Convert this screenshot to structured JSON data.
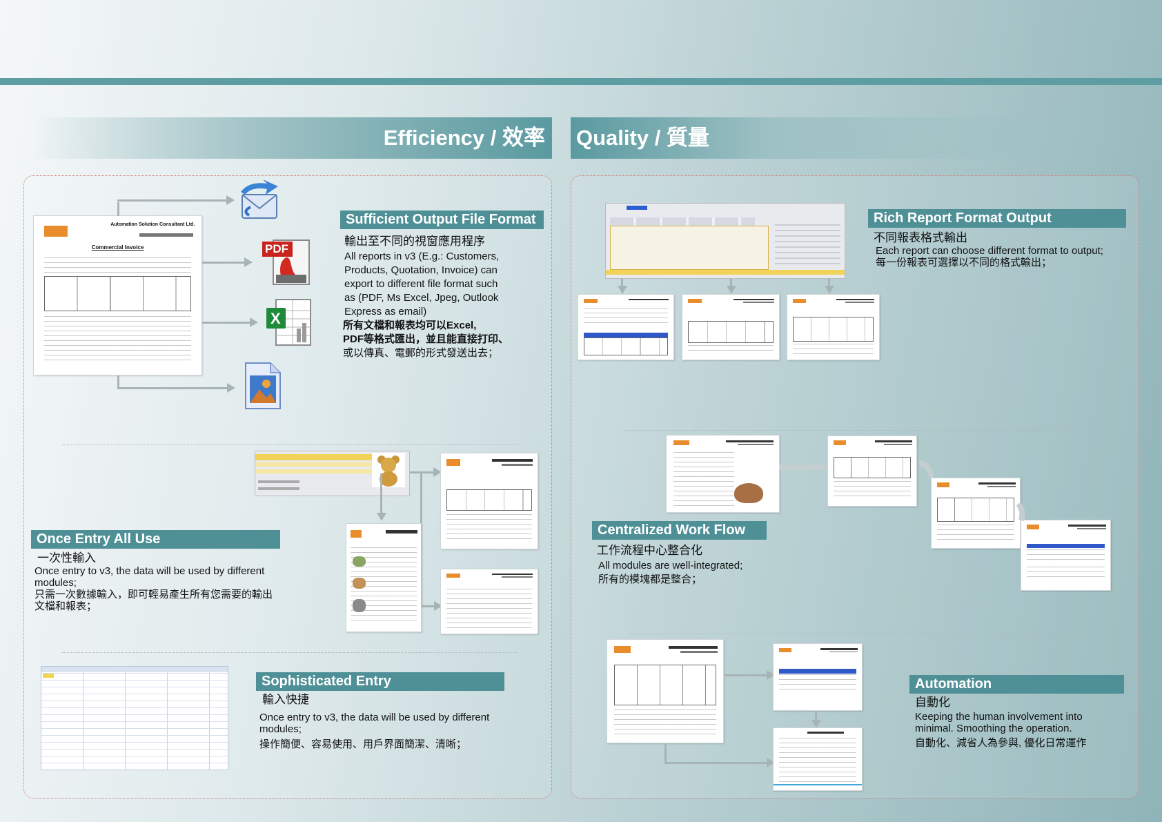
{
  "banners": {
    "efficiency": "Efficiency / 效率",
    "quality": "Quality / 質量"
  },
  "sections": {
    "output_format": {
      "title": "Sufficient Output File Format",
      "zh_title": "輸出至不同的視窗應用程序",
      "lines": [
        "All reports in v3 (E.g.: Customers,",
        "Products, Quotation, Invoice) can",
        "export to different file format  such",
        "as (PDF, Ms Excel, Jpeg, Outlook",
        "Express as email)",
        "所有文檔和報表均可以Excel,",
        "PDF等格式匯出，並且能直接打印、",
        "或以傳真、電郵的形式發送出去；"
      ]
    },
    "once_entry": {
      "title": "Once Entry All Use",
      "zh_title": "一次性輸入",
      "lines": [
        "Once entry to v3, the data will be used by different",
        "modules;",
        "只需一次數據輸入，即可輕易產生所有您需要的輸出",
        "文檔和報表；"
      ]
    },
    "sophisticated": {
      "title": "Sophisticated Entry",
      "zh_title": "輸入快捷",
      "lines": [
        "Once entry to v3, the data will be used by different",
        "modules;",
        "操作簡便、容易使用、用戶界面簡潔、清晰；"
      ]
    },
    "rich_report": {
      "title": "Rich Report Format Output",
      "zh_title": "不同報表格式輸出",
      "lines": [
        "Each report can choose different format to output;",
        "每一份報表可選擇以不同的格式輸出；"
      ]
    },
    "workflow": {
      "title": "Centralized Work Flow",
      "zh_title": "工作流程中心整合化",
      "lines": [
        "All modules are well-integrated;",
        "所有的模塊都是整合；"
      ]
    },
    "automation": {
      "title": "Automation",
      "zh_title": "自動化",
      "lines": [
        "Keeping the human involvement into",
        "minimal. Smoothing the operation.",
        "自動化、減省人為參與, 優化日常運作"
      ]
    }
  },
  "icons": {
    "email": "email-icon",
    "pdf": "pdf-icon",
    "excel": "excel-icon",
    "image": "image-icon"
  },
  "icon_text": {
    "pdf": "PDF",
    "excel": "X"
  },
  "invoice_main": {
    "company": "Automation Solution Consultant Ltd.",
    "doc_title": "Commercial Invoice"
  },
  "colors": {
    "accent": "#4f9097",
    "stripe": "#5e9da2",
    "border_dots": "#d27a7a"
  }
}
